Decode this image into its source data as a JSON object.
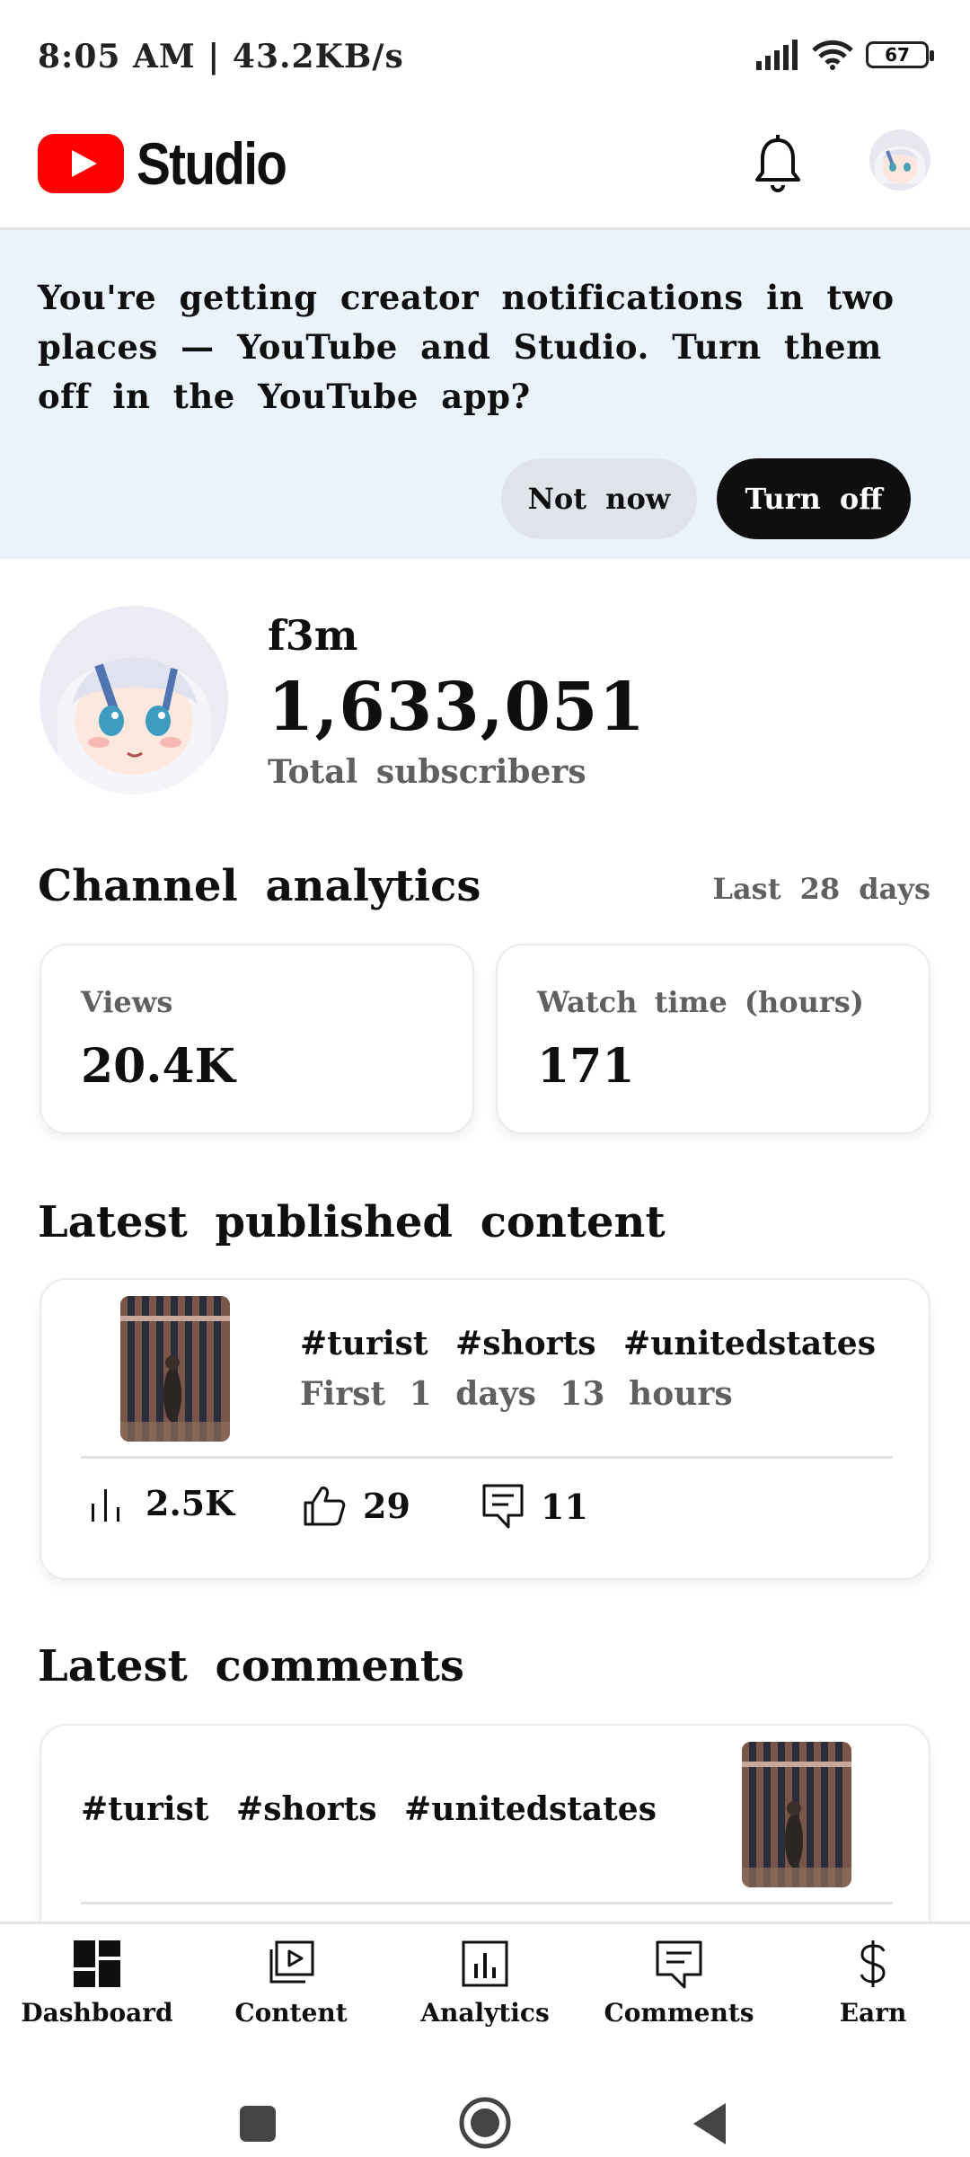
{
  "status_bar": {
    "time": "8:05 AM | 43.2KB/s",
    "battery": "67"
  },
  "header": {
    "app_name": "Studio"
  },
  "banner": {
    "message": "You're getting creator notifications in two places — YouTube and Studio. Turn them off in the YouTube app?",
    "not_now_label": "Not now",
    "turn_off_label": "Turn off"
  },
  "channel": {
    "name": "f3m",
    "subscribers": "1,633,051",
    "subscribers_label": "Total subscribers"
  },
  "analytics": {
    "title": "Channel analytics",
    "range": "Last 28 days",
    "cards": [
      {
        "label": "Views",
        "value": "20.4K"
      },
      {
        "label": "Watch time (hours)",
        "value": "171"
      }
    ]
  },
  "latest_content": {
    "title": "Latest published content",
    "video_title": "#turist  #shorts #unitedstates",
    "age": "First 1 days 13 hours",
    "views": "2.5K",
    "likes": "29",
    "comments": "11"
  },
  "latest_comments": {
    "title": "Latest comments",
    "video_title": "#turist  #shorts #unitedstates"
  },
  "bottom_nav": {
    "items": [
      {
        "label": "Dashboard",
        "icon": "dashboard-icon"
      },
      {
        "label": "Content",
        "icon": "content-icon"
      },
      {
        "label": "Analytics",
        "icon": "analytics-icon"
      },
      {
        "label": "Comments",
        "icon": "comments-icon"
      },
      {
        "label": "Earn",
        "icon": "dollar-icon"
      }
    ]
  },
  "colors": {
    "brand_red": "#ff0000",
    "banner_bg": "#eaf2fc",
    "text": "#0f0f0f",
    "secondary_text": "#606060"
  }
}
